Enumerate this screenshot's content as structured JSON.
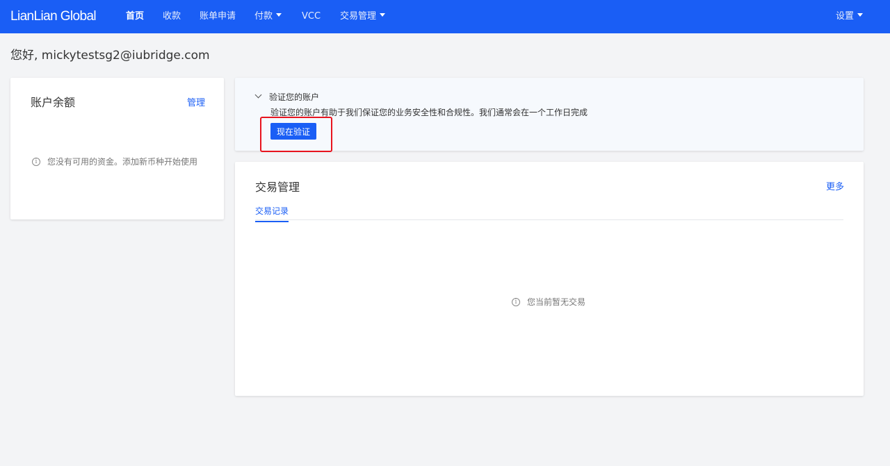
{
  "brand": {
    "logo_text": "LianLian Global",
    "accent_color": "#1a5ef5"
  },
  "nav": {
    "items": [
      {
        "label": "首页",
        "active": true,
        "dropdown": false
      },
      {
        "label": "收款",
        "active": false,
        "dropdown": false
      },
      {
        "label": "账单申请",
        "active": false,
        "dropdown": false
      },
      {
        "label": "付款",
        "active": false,
        "dropdown": true
      },
      {
        "label": "VCC",
        "active": false,
        "dropdown": false
      },
      {
        "label": "交易管理",
        "active": false,
        "dropdown": true
      }
    ],
    "settings_label": "设置"
  },
  "greeting": "您好, mickytestsg2@iubridge.com",
  "balance": {
    "title": "账户余额",
    "manage_label": "管理",
    "empty_text": "您没有可用的资金。添加新币种开始使用",
    "empty_icon": "info-icon"
  },
  "verify": {
    "heading": "验证您的账户",
    "description": "验证您的账户有助于我们保证您的业务安全性和合规性。我们通常会在一个工作日完成",
    "button_label": "现在验证",
    "highlight_color": "#e8141e"
  },
  "transactions": {
    "title": "交易管理",
    "more_label": "更多",
    "tabs": [
      {
        "label": "交易记录",
        "active": true
      }
    ],
    "empty_text": "您当前暂无交易",
    "empty_icon": "info-icon"
  }
}
